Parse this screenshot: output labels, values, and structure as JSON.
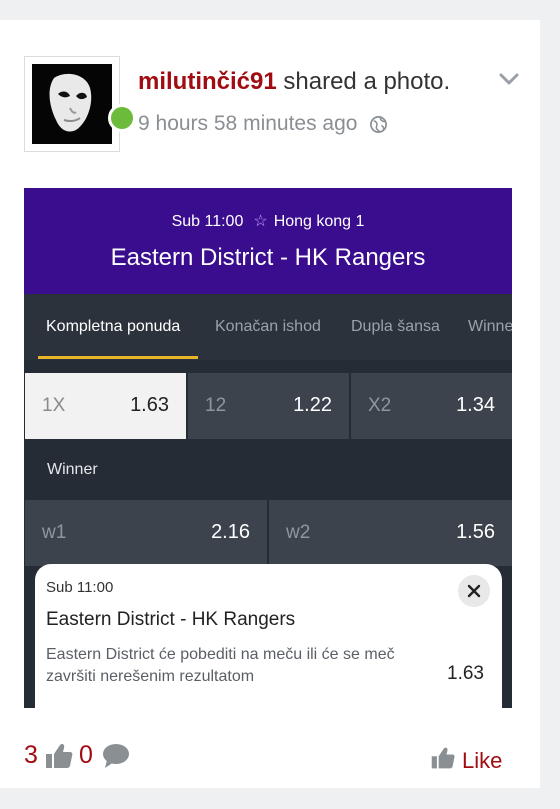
{
  "post": {
    "author": "milutinčić91",
    "action": "shared a photo.",
    "time": "9 hours 58 minutes ago",
    "icons": [
      "globe-icon",
      "chevron-down-icon"
    ]
  },
  "photo": {
    "header": {
      "subline_time": "Sub 11:00",
      "subline_league": "Hong  kong  1",
      "match": "Eastern District - HK Rangers"
    },
    "tabs": [
      "Kompletna ponuda",
      "Konačan ishod",
      "Dupla šansa",
      "Winne"
    ],
    "active_tab": "Kompletna ponuda",
    "double_chance": [
      {
        "label": "1X",
        "odd": "1.63",
        "selected": true
      },
      {
        "label": "12",
        "odd": "1.22",
        "selected": false
      },
      {
        "label": "X2",
        "odd": "1.34",
        "selected": false
      }
    ],
    "winner_section": "Winner",
    "winner": [
      {
        "label": "w1",
        "odd": "2.16"
      },
      {
        "label": "w2",
        "odd": "1.56"
      }
    ],
    "bet_slip": {
      "time": "Sub 11:00",
      "match": "Eastern District - HK Rangers",
      "description": "Eastern District će pobediti na meču ili će se meč završiti nerešenim rezultatom",
      "odd": "1.63"
    }
  },
  "footer": {
    "likes_count": "3",
    "comments_count": "0",
    "like_label": "Like"
  },
  "colors": {
    "author": "#a10c12",
    "header_purple": "#3a0d8f",
    "tab_underline": "#e9b528",
    "online": "#6dbb3a"
  }
}
